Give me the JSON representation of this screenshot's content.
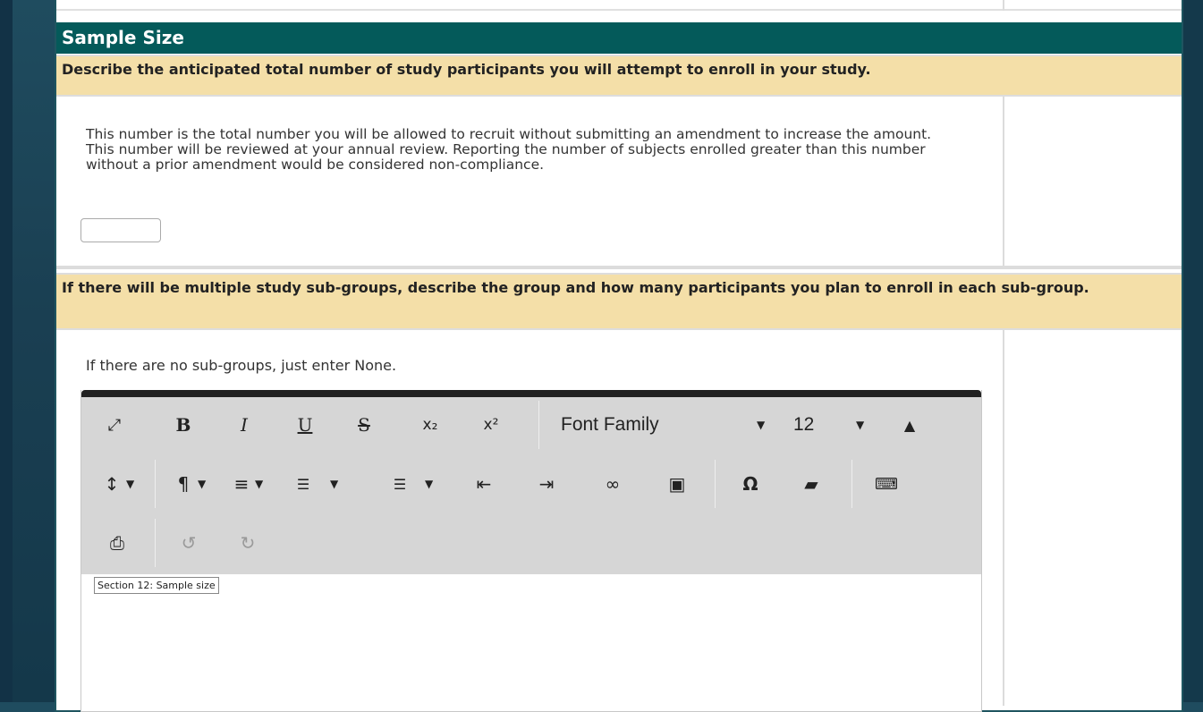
{
  "section": {
    "title": "Sample Size"
  },
  "question1": {
    "text": "Describe the anticipated total number of study participants you will attempt to enroll in your study.",
    "help": "This number is the total number you will be allowed to recruit without submitting an amendment to increase the amount. This number will be reviewed at your annual review. Reporting the number of subjects enrolled greater than this number without a prior amendment would be considered non-compliance.",
    "input_value": ""
  },
  "question2": {
    "text": "If there will be multiple study sub-groups, describe the group and how many participants you plan to enroll in each sub-group.",
    "help": "If there are no sub-groups, just enter None."
  },
  "editor": {
    "toolbar_row1": {
      "fullscreen": "⤢",
      "bold": "B",
      "italic": "I",
      "underline": "U",
      "strike": "S",
      "subscript": "x₂",
      "superscript": "x²",
      "font_family": "Font Family",
      "font_size": "12",
      "color": "▲"
    },
    "toolbar_row2": {
      "line_height": "↕",
      "paragraph": "¶",
      "align": "≡",
      "ordered_list": "☰",
      "unordered_list": "☰",
      "outdent": "⇤",
      "indent": "⇥",
      "link": "∞",
      "image": "▣",
      "special_char": "Ω",
      "eraser": "▰",
      "keyboard": "⌨"
    },
    "toolbar_row3": {
      "print": "⎙",
      "undo": "↺",
      "redo": "↻"
    },
    "caret": "▼",
    "tooltip": "Section 12: Sample size",
    "content": ""
  }
}
